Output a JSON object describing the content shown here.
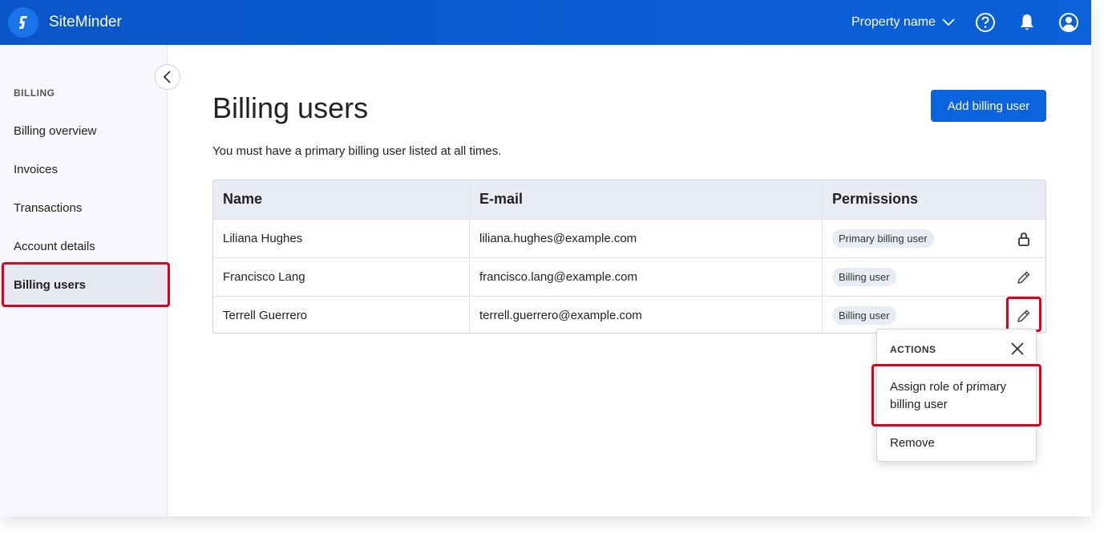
{
  "app": {
    "brand": "SiteMinder",
    "property_label": "Property name",
    "icons": [
      "help-icon",
      "bell-icon",
      "user-icon"
    ]
  },
  "sidebar": {
    "heading": "BILLING",
    "items": [
      {
        "label": "Billing overview",
        "active": false
      },
      {
        "label": "Invoices",
        "active": false
      },
      {
        "label": "Transactions",
        "active": false
      },
      {
        "label": "Account details",
        "active": false
      },
      {
        "label": "Billing users",
        "active": true
      }
    ]
  },
  "main": {
    "title": "Billing users",
    "subtitle": "You must have a primary billing user listed at all times.",
    "add_button": "Add billing user",
    "table": {
      "headers": [
        "Name",
        "E-mail",
        "Permissions"
      ],
      "rows": [
        {
          "name": "Liliana Hughes",
          "email": "liliana.hughes@example.com",
          "permission": "Primary billing user",
          "action_icon": "lock-icon"
        },
        {
          "name": "Francisco Lang",
          "email": "francisco.lang@example.com",
          "permission": "Billing user",
          "action_icon": "pencil-icon"
        },
        {
          "name": "Terrell Guerrero",
          "email": "terrell.guerrero@example.com",
          "permission": "Billing user",
          "action_icon": "pencil-icon"
        }
      ]
    }
  },
  "actions_menu": {
    "heading": "ACTIONS",
    "items": [
      "Assign role of primary billing user",
      "Remove"
    ]
  },
  "colors": {
    "topbar": "#0b5ed7",
    "primary_button": "#0b63dd",
    "highlight": "#e0001b",
    "sidebar_bg": "#f5f7fa"
  }
}
